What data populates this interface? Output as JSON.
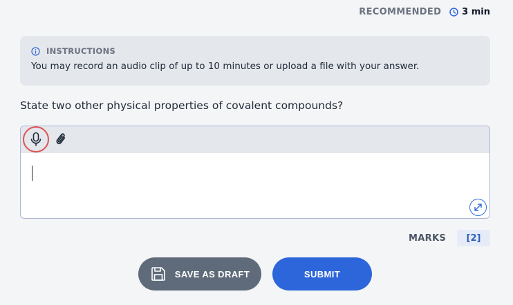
{
  "header": {
    "recommended_label": "RECOMMENDED",
    "recommended_time": "3 min",
    "clock_icon": "clock-icon"
  },
  "instructions": {
    "heading": "INSTRUCTIONS",
    "text": "You may record an audio clip of up to 10 minutes or upload a file with your answer.",
    "icon": "info-icon"
  },
  "question": {
    "text": "State two other physical properties of covalent compounds?"
  },
  "editor": {
    "toolbar": [
      "microphone-icon",
      "paperclip-icon"
    ],
    "value": "",
    "expand_icon": "expand-icon"
  },
  "marks": {
    "label": "MARKS",
    "value": "[2]"
  },
  "actions": {
    "save_draft_label": "SAVE AS DRAFT",
    "submit_label": "SUBMIT"
  },
  "colors": {
    "primary": "#2d66db",
    "secondary": "#5f6b7a",
    "record_ring": "#e05252",
    "panel": "#e4e7ec"
  }
}
